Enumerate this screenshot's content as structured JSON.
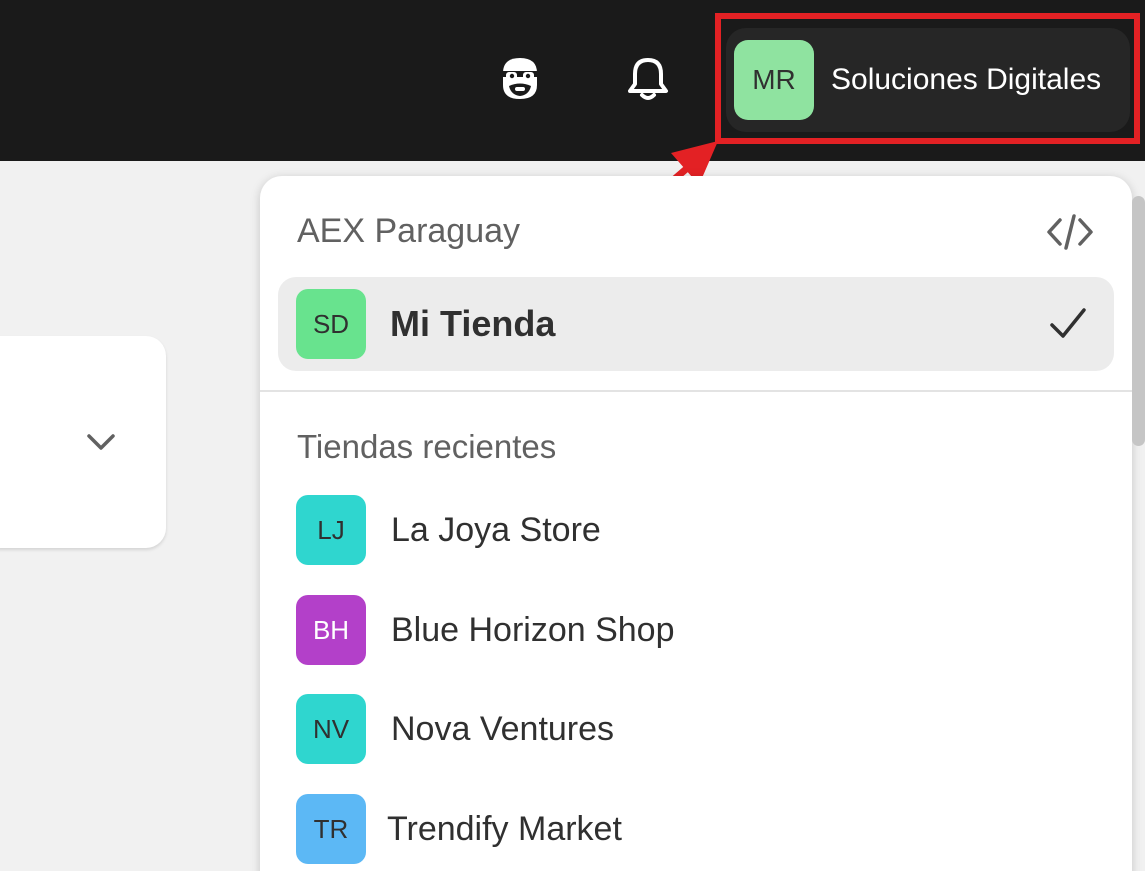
{
  "topbar": {
    "store_switcher": {
      "initials": "MR",
      "name": "Soluciones Digitales",
      "avatar_color": "#8fe3a0"
    }
  },
  "menu": {
    "organization": "AEX Paraguay",
    "current_store": {
      "initials": "SD",
      "name": "Mi Tienda",
      "avatar_color": "#68e38e"
    },
    "recent_title": "Tiendas recientes",
    "recent": [
      {
        "initials": "LJ",
        "name": "La Joya Store",
        "avatar_color": "#2fd6cf",
        "initials_color": "#303030"
      },
      {
        "initials": "BH",
        "name": "Blue Horizon Shop",
        "avatar_color": "#b340c9",
        "initials_color": "#ffffff"
      },
      {
        "initials": "NV",
        "name": "Nova Ventures",
        "avatar_color": "#2fd6cf",
        "initials_color": "#303030"
      },
      {
        "initials": "TR",
        "name": "Trendify Market",
        "avatar_color": "#5cb8f5",
        "initials_color": "#303030"
      }
    ]
  },
  "icons": {
    "sidekick": "sidekick-icon",
    "notifications": "bell-icon",
    "developer": "code-icon",
    "selected": "checkmark-icon",
    "card_expand": "chevron-down-icon"
  },
  "colors": {
    "topbar_bg": "#1a1a1a",
    "highlight": "#e32124",
    "selected_row": "#ececec"
  }
}
